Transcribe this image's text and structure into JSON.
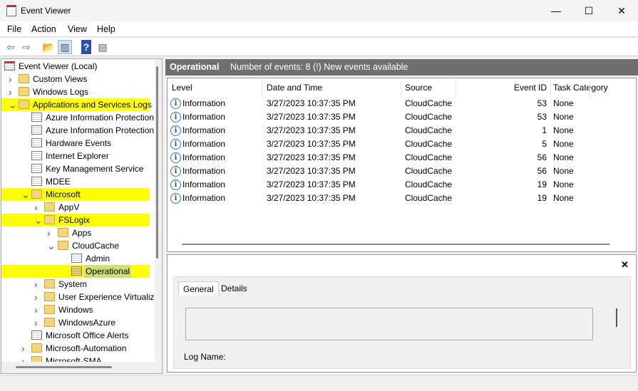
{
  "window": {
    "title": "Event Viewer",
    "minimize": "—",
    "maximize": "☐",
    "close": "✕"
  },
  "menu": [
    "File",
    "Action",
    "View",
    "Help"
  ],
  "toolbar": [
    {
      "icon": "back-arrow-icon",
      "glyph": "⇦",
      "color": "#2a7fd0"
    },
    {
      "icon": "forward-arrow-icon",
      "glyph": "⇨",
      "color": "#777"
    },
    {
      "icon": "open-folder-icon",
      "glyph": "📂",
      "color": "#d9a"
    },
    {
      "icon": "show-hide-console-tree-icon",
      "glyph": "▥",
      "color": "#555"
    },
    {
      "icon": "help-icon",
      "glyph": "?",
      "color": "#fff"
    },
    {
      "icon": "show-hide-action-pane-icon",
      "glyph": "▤",
      "color": "#555"
    }
  ],
  "tree": [
    {
      "label": "Event Viewer (Local)",
      "depth": 0,
      "chevron": "",
      "icon": "event-log"
    },
    {
      "label": "Custom Views",
      "depth": 1,
      "chevron": ">",
      "icon": "folder"
    },
    {
      "label": "Windows Logs",
      "depth": 1,
      "chevron": ">",
      "icon": "folder"
    },
    {
      "label": "Applications and Services Logs",
      "depth": 1,
      "chevron": "v",
      "icon": "folder",
      "highlighted": true
    },
    {
      "label": "Azure Information Protection",
      "depth": 2,
      "chevron": "",
      "icon": "log"
    },
    {
      "label": "Azure Information Protection",
      "depth": 2,
      "chevron": "",
      "icon": "log"
    },
    {
      "label": "Hardware Events",
      "depth": 2,
      "chevron": "",
      "icon": "log"
    },
    {
      "label": "Internet Explorer",
      "depth": 2,
      "chevron": "",
      "icon": "log"
    },
    {
      "label": "Key Management Service",
      "depth": 2,
      "chevron": "",
      "icon": "log"
    },
    {
      "label": "MDEE",
      "depth": 2,
      "chevron": "",
      "icon": "log"
    },
    {
      "label": "Microsoft",
      "depth": 2,
      "chevron": "v",
      "icon": "folder",
      "highlighted": true
    },
    {
      "label": "AppV",
      "depth": 3,
      "chevron": ">",
      "icon": "folder"
    },
    {
      "label": "FSLogix",
      "depth": 3,
      "chevron": "v",
      "icon": "folder",
      "highlighted": true
    },
    {
      "label": "Apps",
      "depth": 4,
      "chevron": ">",
      "icon": "folder"
    },
    {
      "label": "CloudCache",
      "depth": 4,
      "chevron": "v",
      "icon": "folder"
    },
    {
      "label": "Admin",
      "depth": 5,
      "chevron": "",
      "icon": "log"
    },
    {
      "label": "Operational",
      "depth": 5,
      "chevron": "",
      "icon": "log-selected",
      "highlighted": true,
      "selected": true
    },
    {
      "label": "System",
      "depth": 3,
      "chevron": ">",
      "icon": "folder"
    },
    {
      "label": "User Experience Virtualization",
      "depth": 3,
      "chevron": ">",
      "icon": "folder"
    },
    {
      "label": "Windows",
      "depth": 3,
      "chevron": ">",
      "icon": "folder"
    },
    {
      "label": "WindowsAzure",
      "depth": 3,
      "chevron": ">",
      "icon": "folder"
    },
    {
      "label": "Microsoft Office Alerts",
      "depth": 2,
      "chevron": "",
      "icon": "log"
    },
    {
      "label": "Microsoft-Automation",
      "depth": 2,
      "chevron": ">",
      "icon": "folder"
    },
    {
      "label": "Microsoft-SMA",
      "depth": 2,
      "chevron": ">",
      "icon": "folder"
    }
  ],
  "header": {
    "log_name": "Operational",
    "summary": "Number of events: 8 (!) New events available"
  },
  "table": {
    "columns": [
      "Level",
      "Date and Time",
      "Source",
      "Event ID",
      "Task Category"
    ],
    "rows": [
      [
        "Information",
        "3/27/2023 10:37:35 PM",
        "CloudCache",
        "53",
        "None"
      ],
      [
        "Information",
        "3/27/2023 10:37:35 PM",
        "CloudCache",
        "53",
        "None"
      ],
      [
        "Information",
        "3/27/2023 10:37:35 PM",
        "CloudCache",
        "1",
        "None"
      ],
      [
        "Information",
        "3/27/2023 10:37:35 PM",
        "CloudCache",
        "5",
        "None"
      ],
      [
        "Information",
        "3/27/2023 10:37:35 PM",
        "CloudCache",
        "56",
        "None"
      ],
      [
        "Information",
        "3/27/2023 10:37:35 PM",
        "CloudCache",
        "56",
        "None"
      ],
      [
        "Information",
        "3/27/2023 10:37:35 PM",
        "CloudCache",
        "19",
        "None"
      ],
      [
        "Information",
        "3/27/2023 10:37:35 PM",
        "CloudCache",
        "19",
        "None"
      ]
    ]
  },
  "details": {
    "close": "✕",
    "tabs": [
      "General",
      "Details"
    ],
    "log_name_label": "Log Name:"
  },
  "colors": {
    "highlight": "#ffff00",
    "header_bg": "#6f6f6f"
  }
}
